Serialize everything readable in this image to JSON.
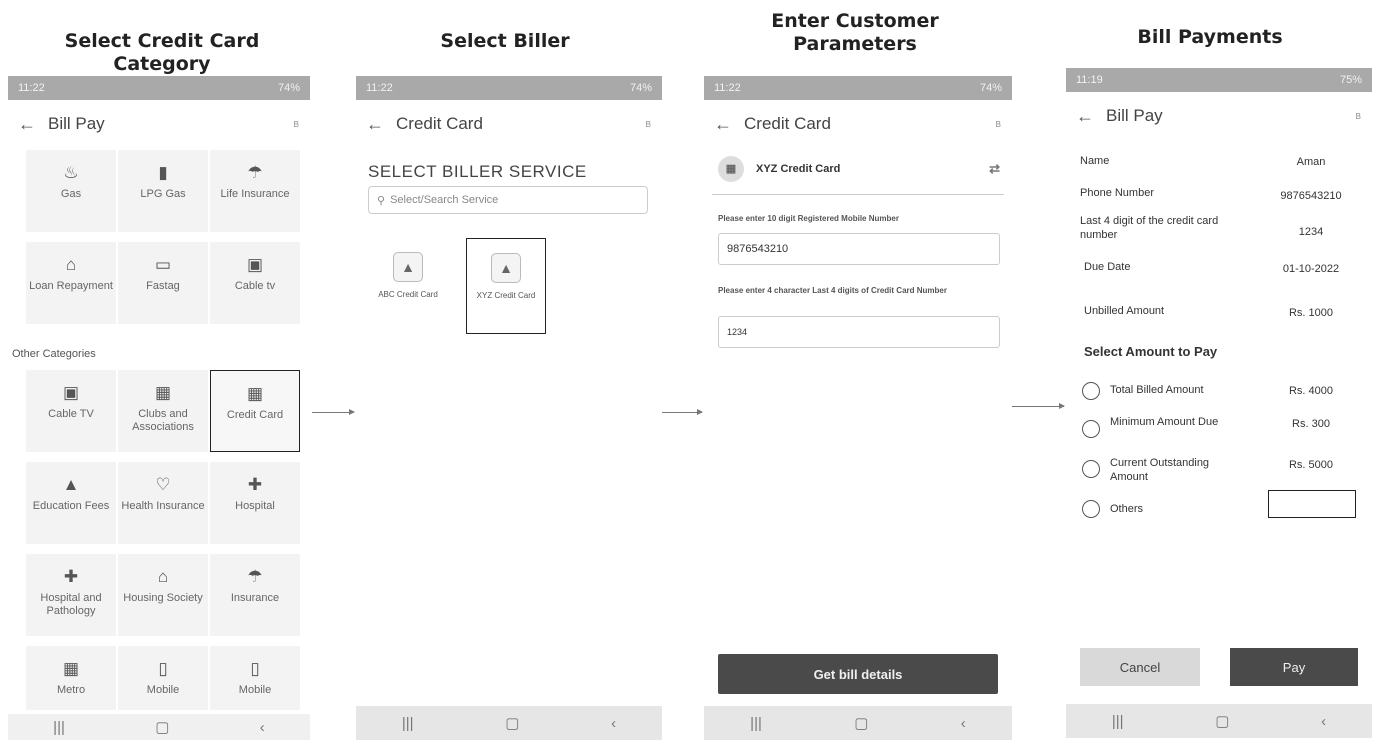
{
  "titles": {
    "step1": "Select Credit Card Category",
    "step2": "Select Biller",
    "step3": "Enter Customer Parameters",
    "step4": "Bill Payments"
  },
  "phone1": {
    "time": "11:22",
    "status": "74%",
    "appbar_title": "Bill Pay",
    "brand": "B",
    "top_categories": [
      {
        "label": "Gas",
        "icon": "gas-icon"
      },
      {
        "label": "LPG Gas",
        "icon": "cylinder-icon"
      },
      {
        "label": "Life Insurance",
        "icon": "umbrella-icon"
      },
      {
        "label": "Loan Repayment",
        "icon": "home-icon"
      },
      {
        "label": "Fastag",
        "icon": "card-icon"
      },
      {
        "label": "Cable tv",
        "icon": "tv-icon"
      }
    ],
    "other_label": "Other Categories",
    "other_categories": [
      {
        "label": "Cable TV",
        "icon": "tv-icon"
      },
      {
        "label": "Clubs and Associations",
        "icon": "building-icon"
      },
      {
        "label": "Credit Card",
        "icon": "card-icon"
      },
      {
        "label": "Education Fees",
        "icon": "graduation-cap-icon"
      },
      {
        "label": "Health Insurance",
        "icon": "heart-icon"
      },
      {
        "label": "Hospital",
        "icon": "hospital-icon"
      },
      {
        "label": "Hospital and Pathology",
        "icon": "hospital-icon"
      },
      {
        "label": "Housing Society",
        "icon": "house-icon"
      },
      {
        "label": "Insurance",
        "icon": "umbrella-icon"
      },
      {
        "label": "Metro",
        "icon": "metro-icon"
      },
      {
        "label": "Mobile",
        "icon": "mobile-icon"
      },
      {
        "label": "Mobile",
        "icon": "mobile-icon"
      }
    ]
  },
  "phone2": {
    "time": "11:22",
    "status": "74%",
    "appbar_title": "Credit Card",
    "brand": "B",
    "heading": "SELECT BILLER SERVICE",
    "search_placeholder": "Select/Search Service",
    "billers": [
      {
        "label": "ABC Credit Card"
      },
      {
        "label": "XYZ Credit Card"
      }
    ]
  },
  "phone3": {
    "time": "11:22",
    "status": "74%",
    "appbar_title": "Credit Card",
    "brand": "B",
    "biller_name": "XYZ Credit Card",
    "mobile_label": "Please enter 10 digit Registered Mobile Number",
    "mobile_value": "9876543210",
    "card_label": "Please enter 4 character Last 4 digits of Credit Card Number",
    "card_value": "1234",
    "button": "Get bill details"
  },
  "phone4": {
    "time": "11:19",
    "status": "75%",
    "appbar_title": "Bill Pay",
    "brand": "B",
    "fields": [
      {
        "label": "Name",
        "value": "Aman"
      },
      {
        "label": "Phone Number",
        "value": "9876543210"
      },
      {
        "label": "Last 4 digit of the credit card number",
        "value": "1234"
      },
      {
        "label": "Due Date",
        "value": "01-10-2022"
      },
      {
        "label": "Unbilled Amount",
        "value": "Rs. 1000"
      }
    ],
    "select_heading": "Select Amount to Pay",
    "options": [
      {
        "label": "Total Billed Amount",
        "value": "Rs. 4000"
      },
      {
        "label": "Minimum Amount Due",
        "value": "Rs. 300"
      },
      {
        "label": "Current Outstanding Amount",
        "value": "Rs. 5000"
      },
      {
        "label": "Others",
        "value": ""
      }
    ],
    "cancel": "Cancel",
    "pay": "Pay"
  }
}
